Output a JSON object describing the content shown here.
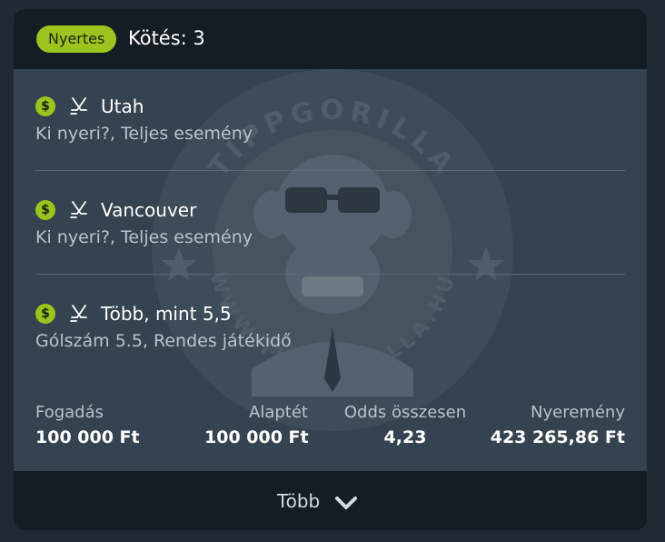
{
  "header": {
    "status_badge": "Nyertes",
    "title": "Kötés: 3"
  },
  "watermark": {
    "brand": "TIPPGORILLA",
    "url": "WWW.TIPPGORILLA.HU"
  },
  "bets": [
    {
      "icon": "dollar-icon",
      "sport_icon": "hockey-icon",
      "selection": "Utah",
      "market": "Ki nyeri?, Teljes esemény"
    },
    {
      "icon": "dollar-icon",
      "sport_icon": "hockey-icon",
      "selection": "Vancouver",
      "market": "Ki nyeri?, Teljes esemény"
    },
    {
      "icon": "dollar-icon",
      "sport_icon": "hockey-icon",
      "selection": "Több, mint 5,5",
      "market": "Gólszám 5.5, Rendes játékidő"
    }
  ],
  "summary": {
    "stake_label": "Fogadás",
    "stake_value": "100 000 Ft",
    "base_label": "Alaptét",
    "base_value": "100 000 Ft",
    "odds_label": "Odds összesen",
    "odds_value": "4,23",
    "win_label": "Nyeremény",
    "win_value": "423 265,86 Ft"
  },
  "footer": {
    "more_label": "Több"
  },
  "colors": {
    "accent": "#9bc41e",
    "card": "#34434f",
    "header": "#151d24"
  }
}
